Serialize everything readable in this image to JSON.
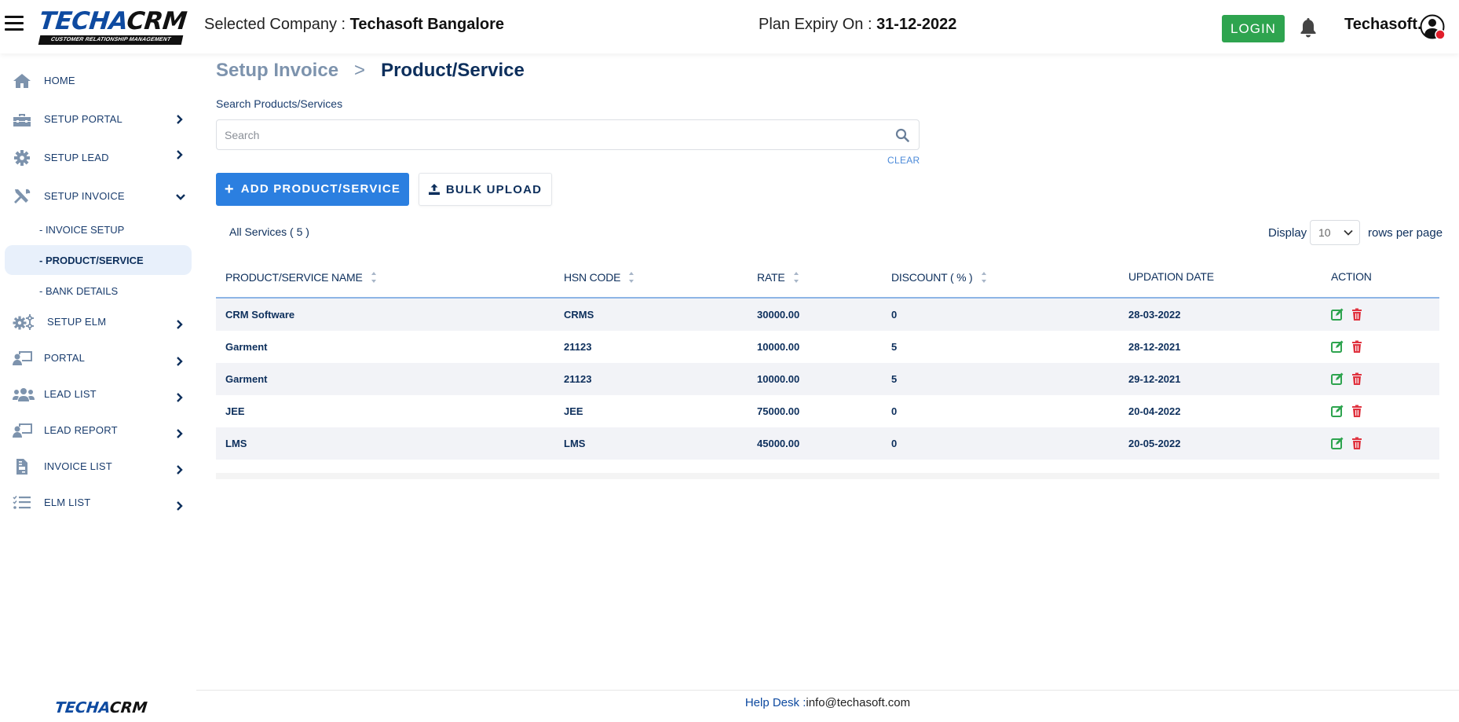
{
  "header": {
    "logo_main": "TECHA",
    "logo_crm": "CRM",
    "logo_tagline": "CUSTOMER RELATIONSHIP MANAGEMENT",
    "company_label": "Selected Company : ",
    "company_value": "Techasoft Bangalore",
    "expiry_label": "Plan Expiry On : ",
    "expiry_value": "31-12-2022",
    "login_label": "LOGIN",
    "user_name": "Techasoft.",
    "colors": {
      "login": "#2ea44f",
      "notification_dot": "#e11d2a"
    }
  },
  "sidebar": {
    "items": [
      {
        "label": "HOME",
        "icon": "home-icon",
        "chevron": "none"
      },
      {
        "label": "SETUP PORTAL",
        "icon": "toolbox-icon",
        "chevron": "right"
      },
      {
        "label": "SETUP LEAD",
        "icon": "gear-icon",
        "chevron": "right"
      },
      {
        "label": "SETUP INVOICE",
        "icon": "tools-icon",
        "chevron": "down"
      },
      {
        "label": "SETUP ELM",
        "icon": "gears-icon",
        "chevron": "right"
      },
      {
        "label": "PORTAL",
        "icon": "presenter-icon",
        "chevron": "right"
      },
      {
        "label": "LEAD LIST",
        "icon": "users-icon",
        "chevron": "right"
      },
      {
        "label": "LEAD REPORT",
        "icon": "presenter-icon",
        "chevron": "right"
      },
      {
        "label": "INVOICE LIST",
        "icon": "document-icon",
        "chevron": "right"
      },
      {
        "label": "ELM LIST",
        "icon": "checklist-icon",
        "chevron": "right"
      }
    ],
    "sub_items": [
      {
        "label": "- INVOICE SETUP",
        "active": false
      },
      {
        "label": "- PRODUCT/SERVICE",
        "active": true
      },
      {
        "label": "- BANK DETAILS",
        "active": false
      }
    ],
    "footer_logo_main": "TECHA",
    "footer_logo_crm": "CRM"
  },
  "main": {
    "breadcrumb": {
      "parent": "Setup Invoice",
      "separator": ">",
      "current": "Product/Service"
    },
    "search": {
      "label": "Search Products/Services",
      "placeholder": "Search",
      "value": "",
      "clear_label": "CLEAR"
    },
    "buttons": {
      "add": "ADD PRODUCT/SERVICE",
      "bulk": "BULK UPLOAD"
    },
    "all_services": "All Services ( 5 )",
    "pagination": {
      "display_label": "Display",
      "rows_value": "10",
      "rows_label": "rows per page"
    },
    "table": {
      "columns": [
        "PRODUCT/SERVICE NAME",
        "HSN CODE",
        "RATE",
        "DISCOUNT ( % )",
        "UPDATION DATE",
        "ACTION"
      ],
      "rows": [
        {
          "name": "CRM Software",
          "hsn": "CRMS",
          "rate": "30000.00",
          "discount": "0",
          "date": "28-03-2022"
        },
        {
          "name": "Garment",
          "hsn": "21123",
          "rate": "10000.00",
          "discount": "5",
          "date": "28-12-2021"
        },
        {
          "name": "Garment",
          "hsn": "21123",
          "rate": "10000.00",
          "discount": "5",
          "date": "29-12-2021"
        },
        {
          "name": "JEE",
          "hsn": "JEE",
          "rate": "75000.00",
          "discount": "0",
          "date": "20-04-2022"
        },
        {
          "name": "LMS",
          "hsn": "LMS",
          "rate": "45000.00",
          "discount": "0",
          "date": "20-05-2022"
        }
      ],
      "colors": {
        "edit": "#2ea44f",
        "delete": "#e0323f",
        "header_border": "#8eb5e6"
      }
    }
  },
  "footer": {
    "help_label": "Help Desk : ",
    "help_email": "info@techasoft.com"
  }
}
